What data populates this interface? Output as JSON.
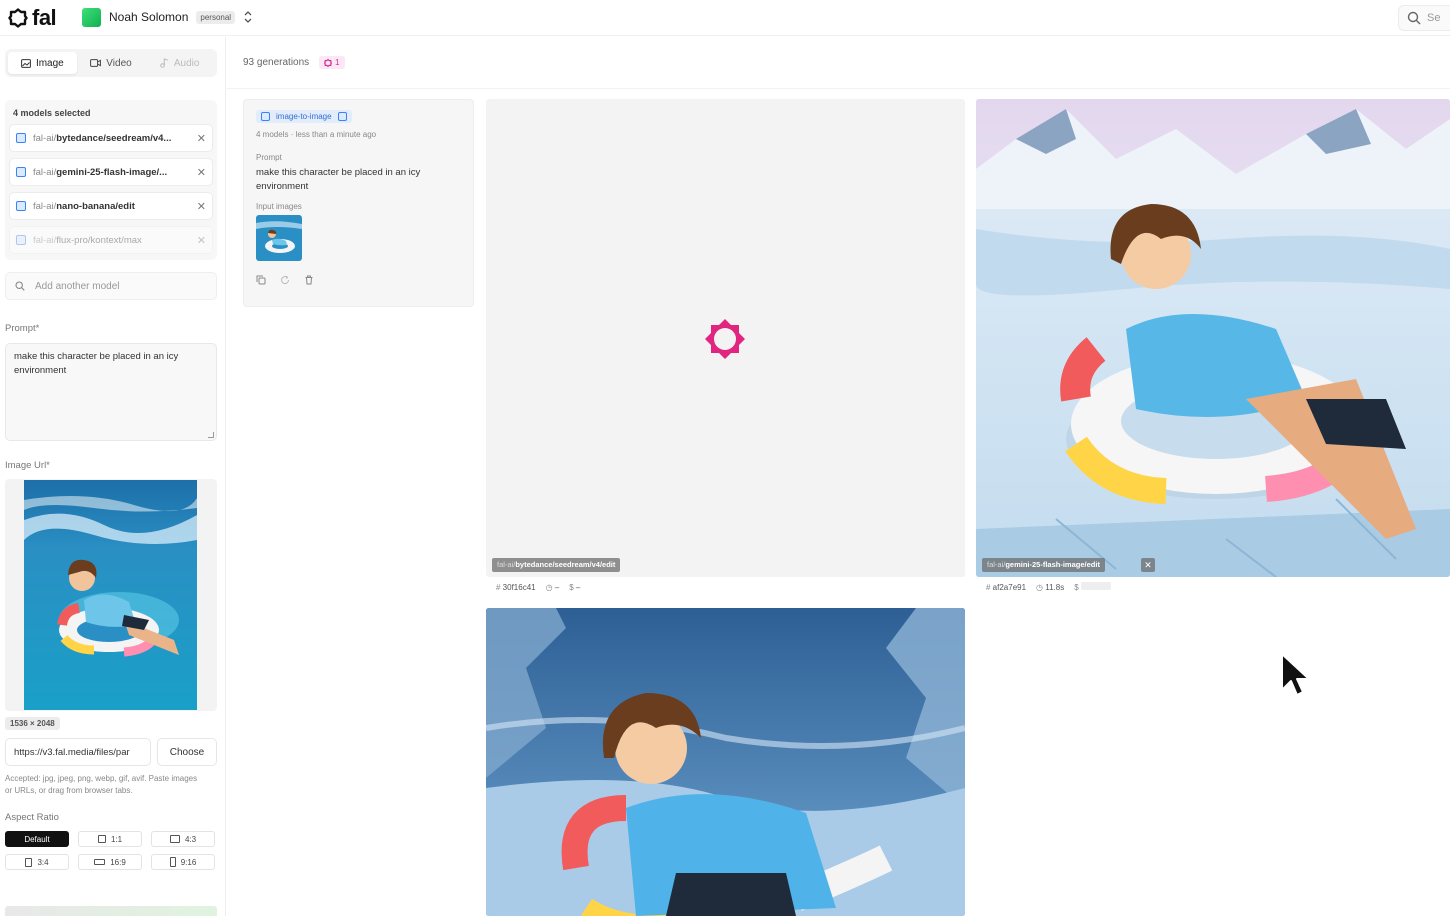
{
  "topbar": {
    "logo_text": "fal",
    "user_name": "Noah Solomon",
    "plan_badge": "personal",
    "search_placeholder": "Se"
  },
  "sidebar": {
    "tabs": [
      {
        "label": "Image",
        "icon": "image-icon",
        "state": "active"
      },
      {
        "label": "Video",
        "icon": "video-icon",
        "state": "normal"
      },
      {
        "label": "Audio",
        "icon": "audio-icon",
        "state": "disabled"
      }
    ],
    "models_title": "4 models selected",
    "models": [
      {
        "prefix": "fal-ai/",
        "name": "bytedance/seedream/v4..."
      },
      {
        "prefix": "fal-ai/",
        "name": "gemini-25-flash-image/..."
      },
      {
        "prefix": "fal-ai/",
        "name": "nano-banana/edit"
      },
      {
        "prefix": "fal-ai/",
        "name": "flux-pro/kontext/max"
      }
    ],
    "add_model_placeholder": "Add another model",
    "prompt_label": "Prompt*",
    "prompt_value": "make this character be placed in an icy environment",
    "image_url_label": "Image Url*",
    "image_dims": "1536 × 2048",
    "image_url_value": "https://v3.fal.media/files/par",
    "choose_label": "Choose",
    "hint_text": "Accepted: jpg, jpeg, png, webp, gif, avif. Paste images or URLs, or drag from browser tabs.",
    "aspect_label": "Aspect Ratio",
    "aspect_options": [
      "Default",
      "1:1",
      "4:3",
      "3:4",
      "16:9",
      "9:16"
    ],
    "aspect_selected": "Default"
  },
  "main": {
    "generations_count": "93 generations",
    "badge_count": "1",
    "request": {
      "tag": "image-to-image",
      "models_count": "4 models",
      "time": "less than a minute ago",
      "prompt_label": "Prompt",
      "prompt": "make this character be placed in an icy environment",
      "input_images_label": "Input images"
    },
    "results": [
      {
        "model_prefix": "fal-ai/",
        "model_name": "bytedance/seedream/v4/edit",
        "id": "30f16c41",
        "time": "–",
        "cost": "–",
        "status": "loading"
      },
      {
        "model_prefix": "fal-ai/",
        "model_name": "gemini-25-flash-image/edit",
        "id": "af2a7e91",
        "time": "11.8s",
        "cost": "",
        "status": "done"
      }
    ]
  },
  "colors": {
    "accent_pink": "#e0267f",
    "accent_blue": "#3b82f6",
    "active_dark": "#111111"
  }
}
